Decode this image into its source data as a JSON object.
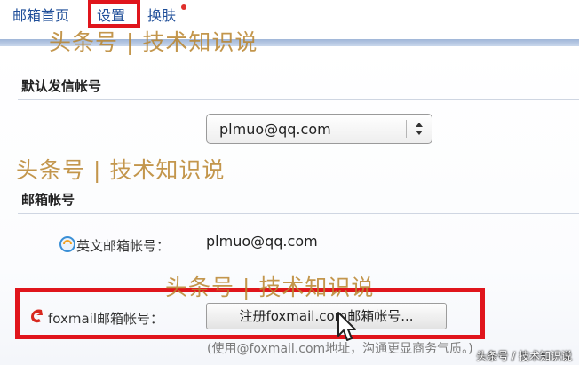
{
  "nav": {
    "home": "邮箱首页",
    "settings": "设置",
    "skin": "换肤"
  },
  "default_sender": {
    "title": "默认发信帐号",
    "selected": "plmuo@qq.com"
  },
  "accounts": {
    "title": "邮箱帐号",
    "english_label": "英文邮箱帐号：",
    "english_value": "plmuo@qq.com",
    "foxmail_label": "foxmail邮箱帐号：",
    "register_button": "注册foxmail.com邮箱帐号...",
    "hint": "(使用@foxmail.com地址，沟通更显商务气质。)"
  },
  "watermark": {
    "text": "头条号 | 技术知识说",
    "corner": "头条号 / 技术知识说"
  },
  "colors": {
    "highlight": "#e0151c",
    "link": "#1f4e99",
    "watermark": "#b8842d"
  }
}
